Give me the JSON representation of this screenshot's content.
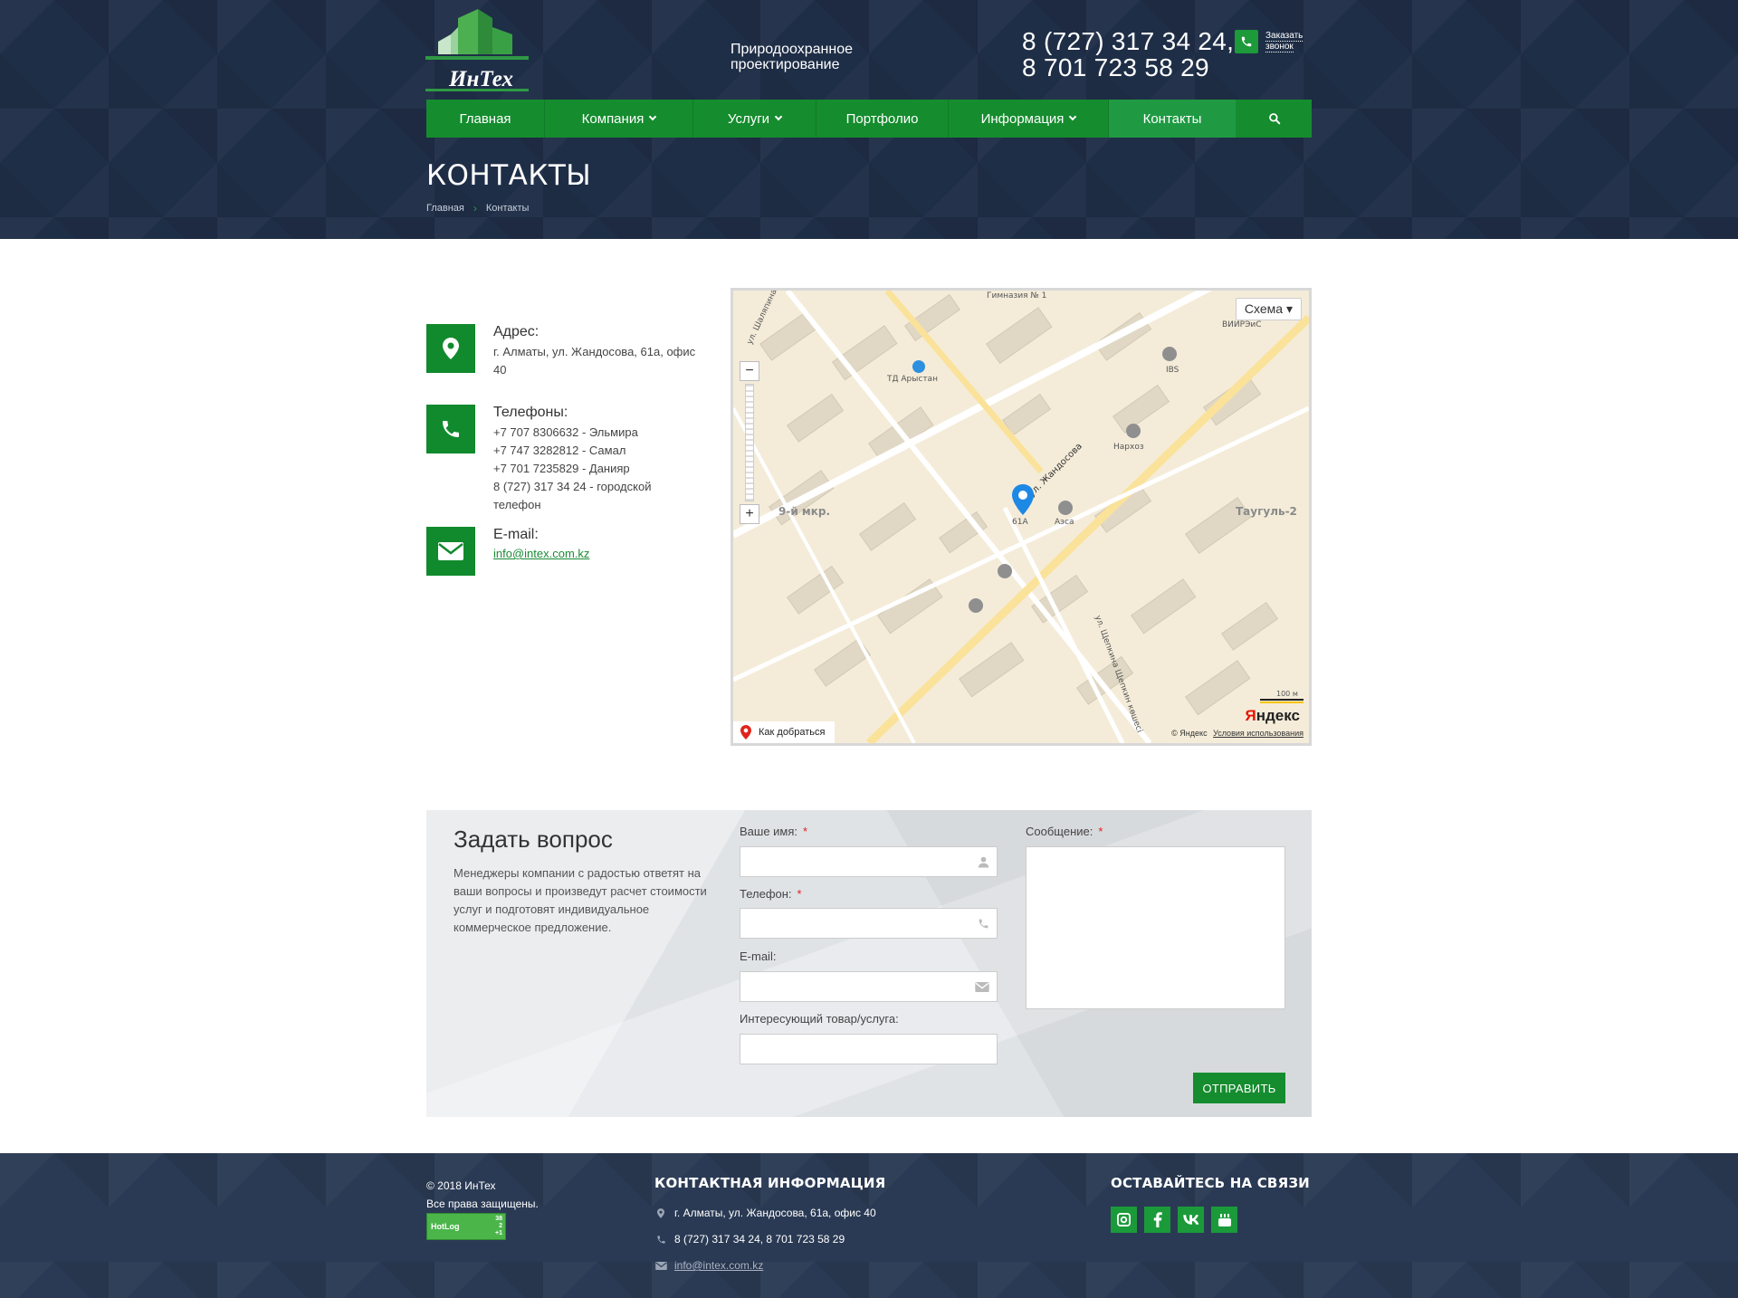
{
  "header": {
    "logo_text": "ИнТех",
    "tagline": "Природоохранное проектирование",
    "phone_1": "8 (727) 317 34 24,",
    "phone_2": "8 701 723 58 29",
    "callback_1": "Заказать",
    "callback_2": "звонок"
  },
  "nav": [
    {
      "label": "Главная",
      "dropdown": false
    },
    {
      "label": "Компания",
      "dropdown": true
    },
    {
      "label": "Услуги",
      "dropdown": true
    },
    {
      "label": "Портфолио",
      "dropdown": false
    },
    {
      "label": "Информация",
      "dropdown": true
    },
    {
      "label": "Контакты",
      "dropdown": false,
      "active": true
    }
  ],
  "page": {
    "title": "КОНТАКТЫ",
    "breadcrumb_home": "Главная",
    "breadcrumb_current": "Контакты"
  },
  "contacts": {
    "address_title": "Адрес:",
    "address": "г. Алматы, ул. Жандосова, 61а, офис 40",
    "phones_title": "Телефоны:",
    "phones": [
      "+7 707 8306632 - Эльмира",
      "+7 747 3282812 - Самал",
      "+7 701 7235829 - Данияр",
      "8 (727) 317 34 24 - городской телефон"
    ],
    "email_title": "E-mail:",
    "email": "info@intex.com.kz"
  },
  "map": {
    "layer": "Схема",
    "route": "Как добраться",
    "copyright": "© Яндекс",
    "terms": "Условия использования",
    "brand_y": "Я",
    "brand_rest": "ндекс",
    "labels": [
      "ул. Жандосова",
      "9-й мкр.",
      "Таугуль-2",
      "ТД Арыстан",
      "Нархоз",
      "Аэса",
      "IBS",
      "ВИИРЭиС",
      "Гимназия № 1",
      "ул. Щепкина Щепкин көшесі",
      "ул. Шаляпина",
      "61А",
      "100 м"
    ]
  },
  "form": {
    "title": "Задать вопрос",
    "description": "Менеджеры компании с радостью ответят на ваши вопросы и произведут расчет стоимости услуг и подготовят индивидуальное коммерческое предложение.",
    "name_label": "Ваше имя:",
    "phone_label": "Телефон:",
    "email_label": "E-mail:",
    "product_label": "Интересующий товар/услуга:",
    "message_label": "Сообщение:",
    "required_mark": "*",
    "submit": "ОТПРАВИТЬ"
  },
  "footer": {
    "copyright": "© 2018 ИнТех",
    "rights": "Все права защищены.",
    "counter_label": "HotLog",
    "counter_nums": [
      "38",
      "2",
      "+1"
    ],
    "contact_title": "КОНТАКТНАЯ ИНФОРМАЦИЯ",
    "address": "г. Алматы, ул. Жандосова, 61а, офис 40",
    "phones": "8 (727) 317 34 24, 8 701 723 58 29",
    "email": "info@intex.com.kz",
    "social_title": "ОСТАВАЙТЕСЬ НА СВЯЗИ",
    "social": [
      "instagram-icon",
      "facebook-icon",
      "vk-icon",
      "youtube-icon"
    ]
  },
  "colors": {
    "accent_green": "#158c2e",
    "header_bg": "#1f2e47",
    "footer_bg": "#2a3a54"
  }
}
